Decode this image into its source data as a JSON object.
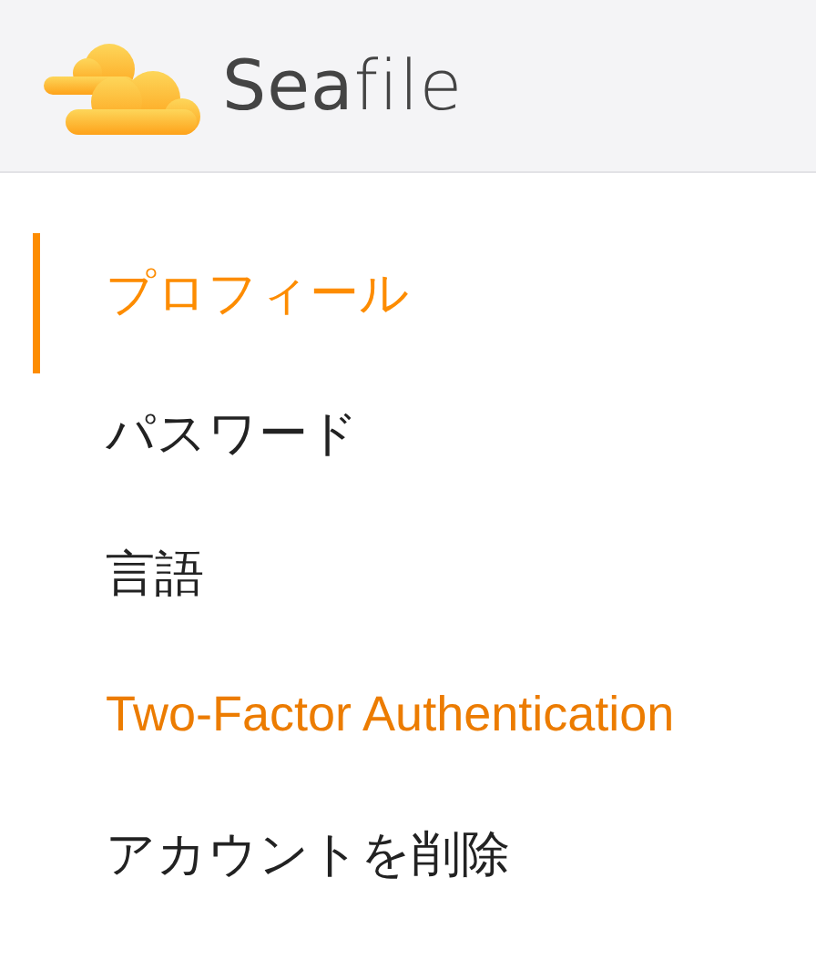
{
  "header": {
    "logo_text": "**Sea**file"
  },
  "nav": [
    {
      "label": "プロフィール",
      "selected": true,
      "kind": "tab"
    },
    {
      "label": "パスワード",
      "selected": false,
      "kind": "tab"
    },
    {
      "label": "言語",
      "selected": false,
      "kind": "tab"
    },
    {
      "label": "Two-Factor Authentication",
      "selected": false,
      "kind": "link"
    },
    {
      "label": "アカウントを削除",
      "selected": false,
      "kind": "tab"
    }
  ]
}
